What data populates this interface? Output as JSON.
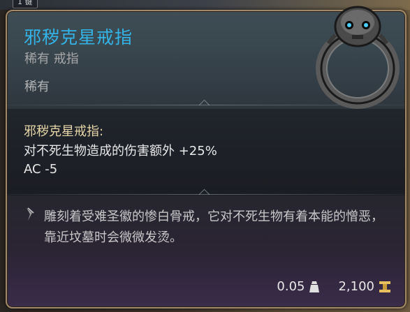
{
  "background": {
    "hint_key": "1 键"
  },
  "item": {
    "name": "邪秽克星戒指",
    "type_line": "稀有 戒指",
    "rarity": "稀有",
    "effects_title": "邪秽克星戒指:",
    "effects": [
      "对不死生物造成的伤害额外 +25%",
      "AC -5"
    ],
    "description": "雕刻着受难圣徽的惨白骨戒，它对不死生物有着本能的憎恶，靠近坟墓时会微微发烫。",
    "weight": "0.05",
    "value": "2,100"
  },
  "colors": {
    "name": "#33b3e6",
    "border": "#a08868",
    "effects_title": "#e6d6a8"
  },
  "icons": {
    "weight": "weight-icon",
    "gold": "gold-coin-icon",
    "lore": "quill-icon",
    "item": "skull-ring-icon"
  }
}
